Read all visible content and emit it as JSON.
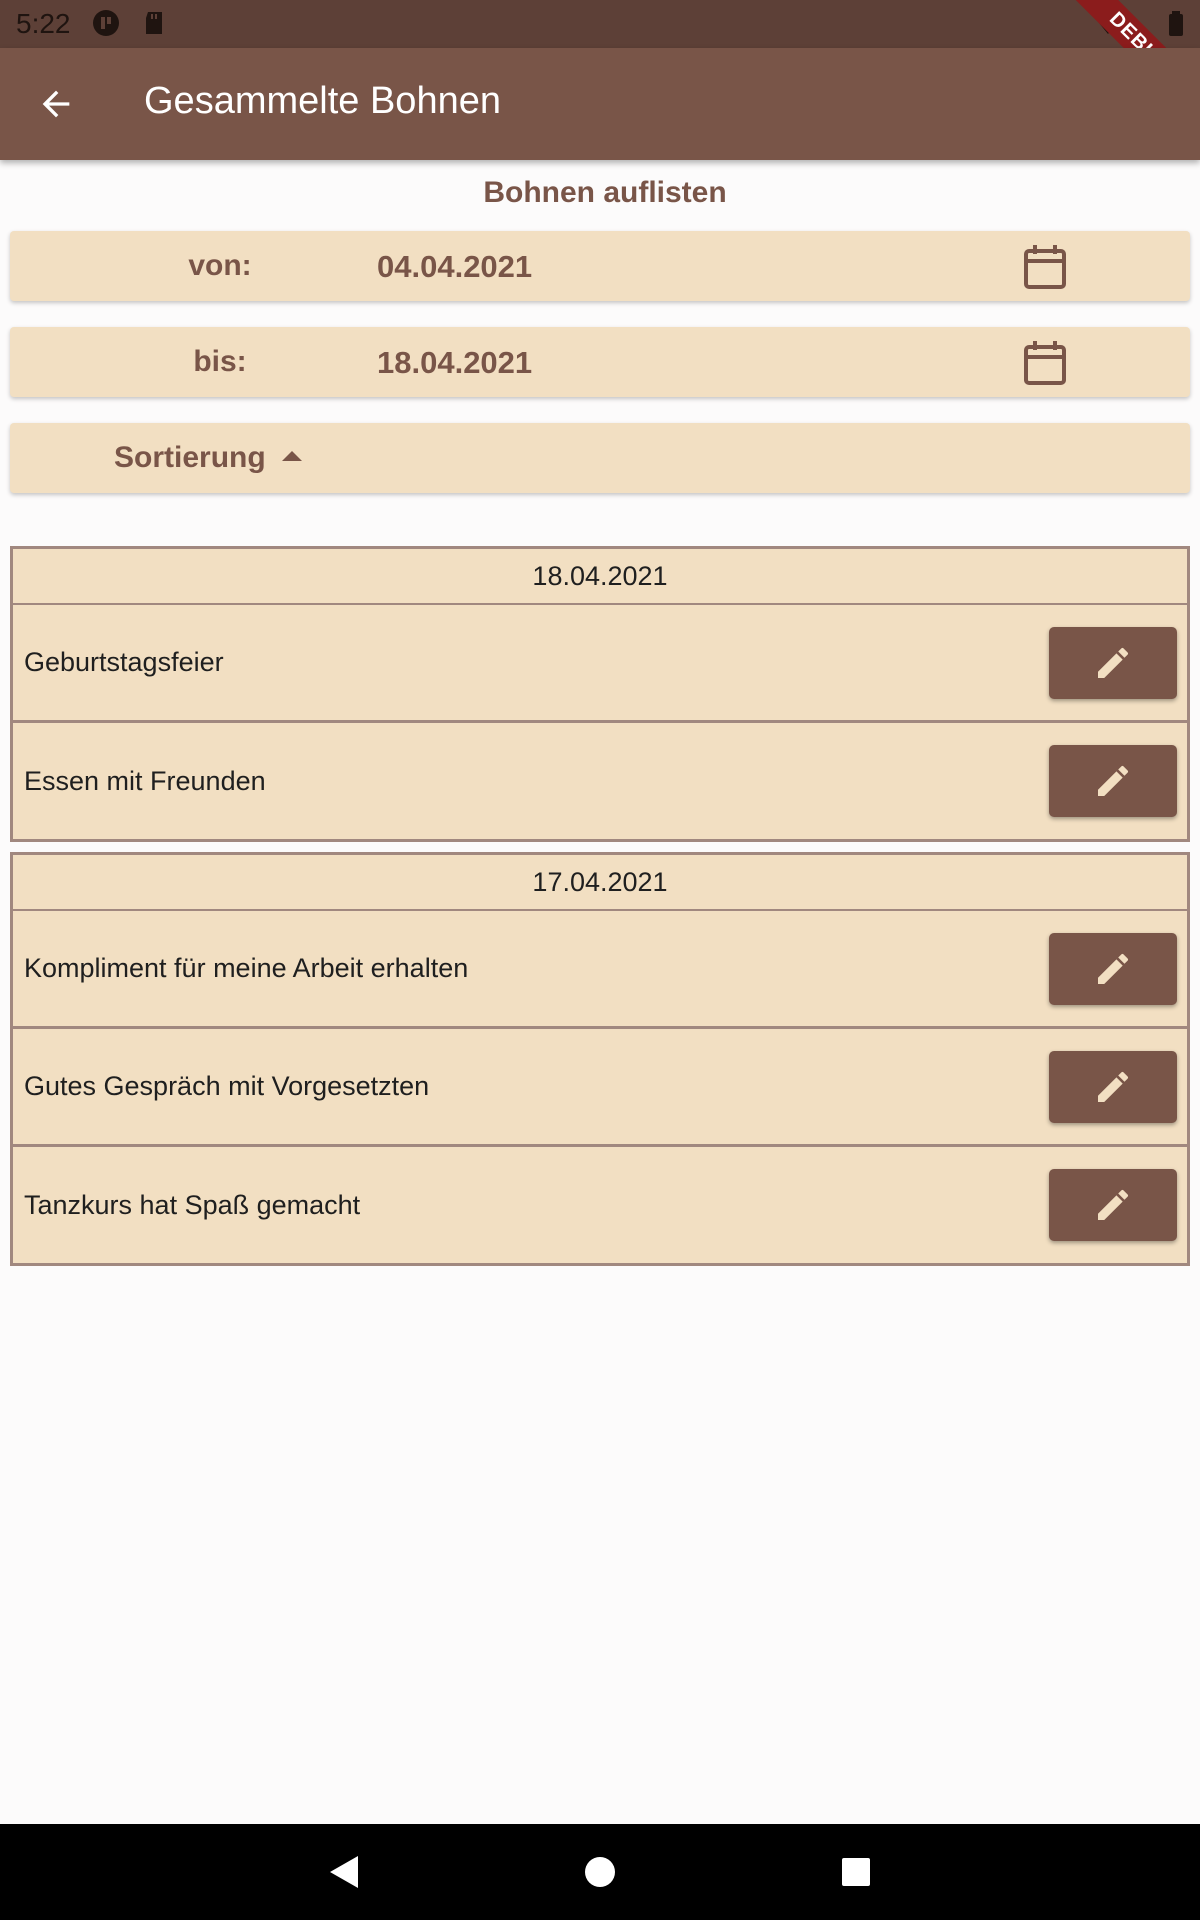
{
  "status_bar": {
    "time": "5:22",
    "icons": [
      "app-notification-icon",
      "sd-card-icon",
      "wifi-icon",
      "battery-icon"
    ],
    "debug_banner": "DEBUG"
  },
  "app_bar": {
    "title": "Gesammelte Bohnen",
    "back_icon": "arrow-back-icon"
  },
  "filter": {
    "heading": "Bohnen auflisten",
    "from_label": "von:",
    "from_date": "04.04.2021",
    "to_label": "bis:",
    "to_date": "18.04.2021",
    "calendar_icon": "calendar-icon",
    "sort_label": "Sortierung",
    "sort_icon": "arrow-drop-up-icon"
  },
  "groups": [
    {
      "date": "18.04.2021",
      "entries": [
        "Geburtstagsfeier",
        "Essen mit Freunden"
      ]
    },
    {
      "date": "17.04.2021",
      "entries": [
        "Kompliment für meine Arbeit erhalten",
        "Gutes Gespräch mit Vorgesetzten",
        "Tanzkurs hat Spaß gemacht"
      ]
    }
  ],
  "colors": {
    "primary": "#795548",
    "primary_dark": "#5d4037",
    "card": "#f2dfc2",
    "border": "#a1887f",
    "background": "#fcfbfb"
  },
  "nav_bar": {
    "icons": [
      "nav-back-icon",
      "nav-home-icon",
      "nav-recents-icon"
    ]
  }
}
